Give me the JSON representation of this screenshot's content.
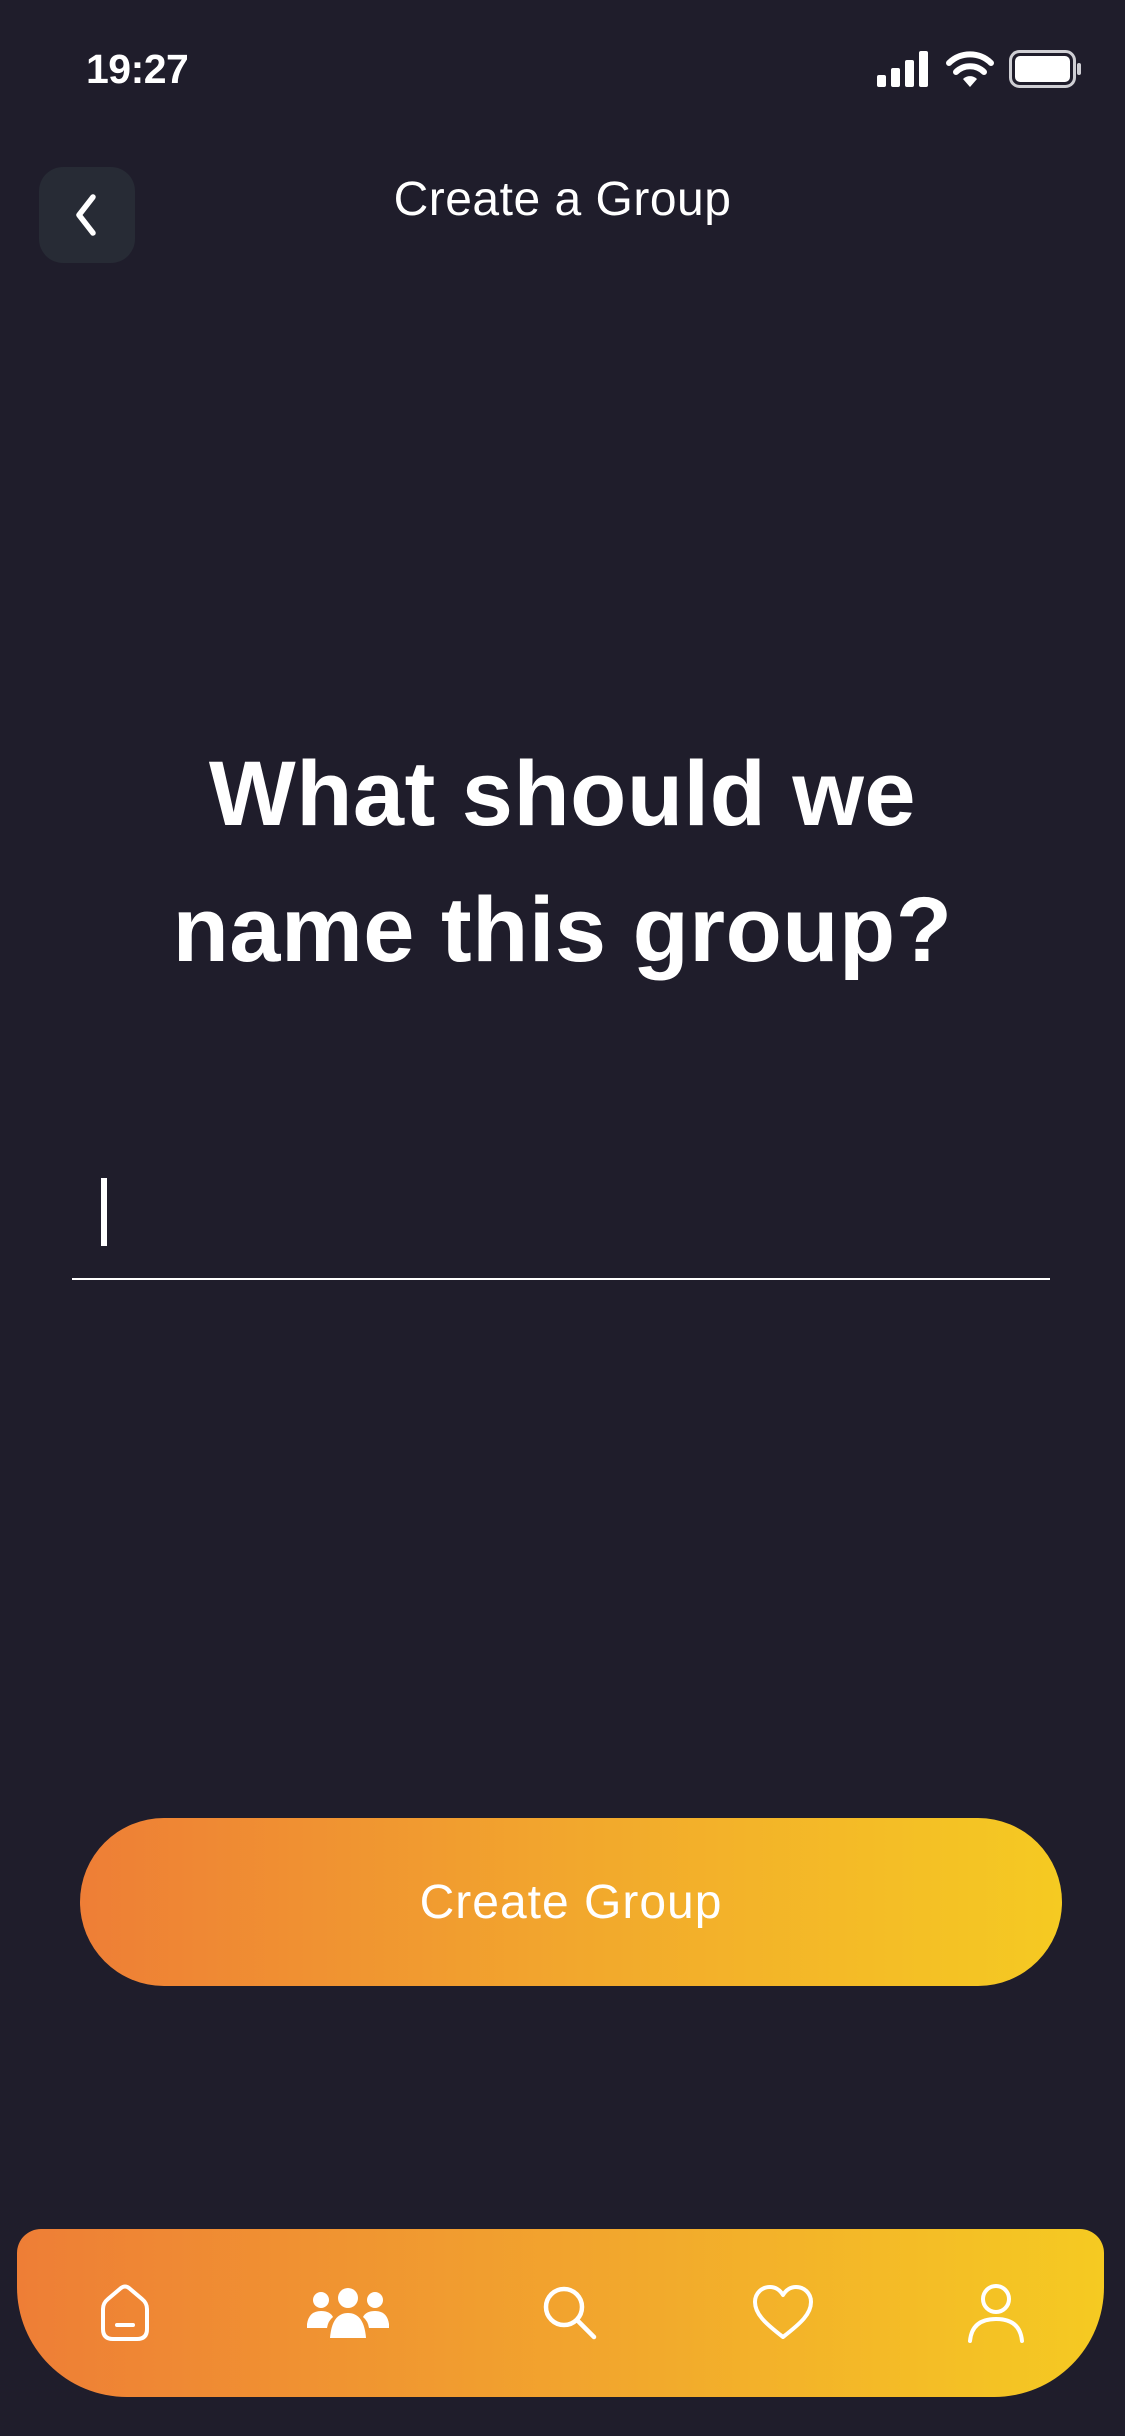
{
  "status_bar": {
    "time": "19:27",
    "icons": [
      "signal-icon",
      "wifi-icon",
      "battery-icon"
    ]
  },
  "header": {
    "title": "Create a Group",
    "back_icon": "chevron-left-icon"
  },
  "main": {
    "question": "What should we name this group?",
    "input": {
      "value": "",
      "placeholder": ""
    },
    "cta_label": "Create Group"
  },
  "bottom_nav": {
    "items": [
      {
        "icon": "home-icon"
      },
      {
        "icon": "groups-icon"
      },
      {
        "icon": "search-icon"
      },
      {
        "icon": "heart-icon"
      },
      {
        "icon": "profile-icon"
      }
    ]
  },
  "colors": {
    "background": "#1f1d2b",
    "back_button": "#272b35",
    "accent_start": "#ee7e36",
    "accent_end": "#f5ca22",
    "text": "#ffffff"
  }
}
